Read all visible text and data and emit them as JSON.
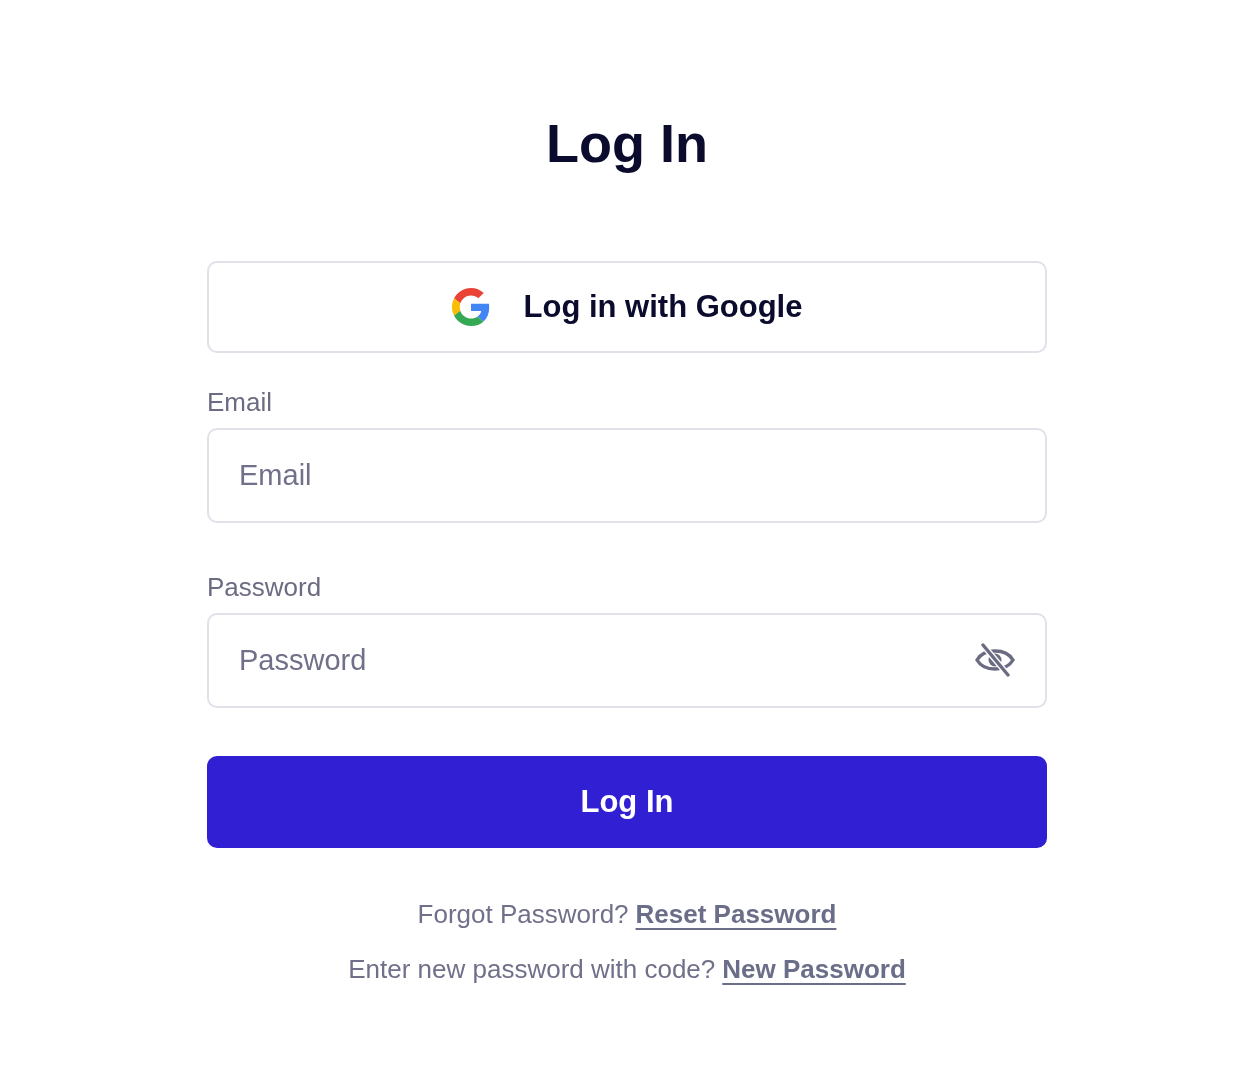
{
  "title": "Log In",
  "google_button": {
    "label": "Log in with Google"
  },
  "fields": [
    {
      "kind": "email",
      "label": "Email",
      "placeholder": "Email"
    },
    {
      "kind": "password",
      "label": "Password",
      "placeholder": "Password",
      "visible": false
    }
  ],
  "submit_button": {
    "label": "Log In"
  },
  "help_links": [
    {
      "prompt": "Forgot Password?",
      "link": "Reset Password"
    },
    {
      "prompt": "Enter new password with code?",
      "link": "New Password"
    }
  ]
}
